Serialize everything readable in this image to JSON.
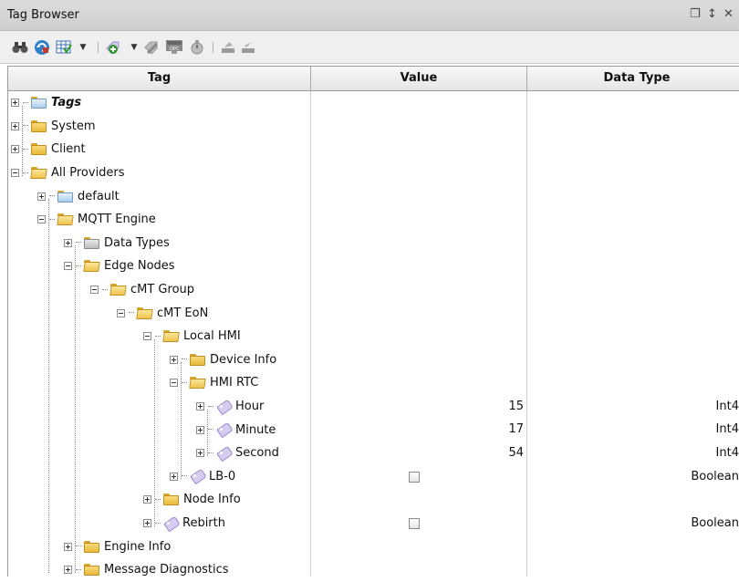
{
  "window": {
    "title": "Tag Browser",
    "restore_icon": "restore-window-icon",
    "pin_icon": "pin-icon",
    "close_icon": "close-icon"
  },
  "toolbar": {
    "buttons": [
      {
        "name": "binoculars-icon"
      },
      {
        "name": "refresh-icon"
      },
      {
        "name": "table-icon"
      },
      {
        "name": "add-tag-icon"
      },
      {
        "name": "edit-tag-icon"
      },
      {
        "name": "opc-browser-icon"
      },
      {
        "name": "tag-history-icon"
      },
      {
        "name": "import-icon"
      },
      {
        "name": "export-icon"
      }
    ]
  },
  "columns": {
    "tag": "Tag",
    "value": "Value",
    "data_type": "Data Type"
  },
  "tree": [
    {
      "label": "Tags",
      "bold": true,
      "expanded": false,
      "icon": "folder-blue-icon",
      "value": "",
      "type": ""
    },
    {
      "label": "System",
      "expanded": false,
      "icon": "folder-icon",
      "value": "",
      "type": ""
    },
    {
      "label": "Client",
      "expanded": false,
      "icon": "folder-icon",
      "value": "",
      "type": ""
    },
    {
      "label": "All Providers",
      "expanded": true,
      "icon": "folder-open-icon",
      "value": "",
      "type": ""
    },
    {
      "label": "default",
      "expanded": false,
      "icon": "folder-blue-icon",
      "value": "",
      "type": ""
    },
    {
      "label": "MQTT Engine",
      "expanded": true,
      "icon": "folder-open-icon",
      "value": "",
      "type": ""
    },
    {
      "label": "Data Types",
      "expanded": false,
      "icon": "folder-gray-icon",
      "value": "",
      "type": ""
    },
    {
      "label": "Edge Nodes",
      "expanded": true,
      "icon": "folder-open-icon",
      "value": "",
      "type": ""
    },
    {
      "label": "cMT Group",
      "expanded": true,
      "icon": "folder-open-icon",
      "value": "",
      "type": ""
    },
    {
      "label": "cMT EoN",
      "expanded": true,
      "icon": "folder-open-icon",
      "value": "",
      "type": ""
    },
    {
      "label": "Local HMI",
      "expanded": true,
      "icon": "folder-open-icon",
      "value": "",
      "type": ""
    },
    {
      "label": "Device Info",
      "expanded": false,
      "icon": "folder-icon",
      "value": "",
      "type": ""
    },
    {
      "label": "HMI RTC",
      "expanded": true,
      "icon": "folder-open-icon",
      "value": "",
      "type": ""
    },
    {
      "label": "Hour",
      "expanded": false,
      "icon": "tag-icon",
      "value": "15",
      "type": "Int4"
    },
    {
      "label": "Minute",
      "expanded": false,
      "icon": "tag-icon",
      "value": "17",
      "type": "Int4"
    },
    {
      "label": "Second",
      "expanded": false,
      "icon": "tag-icon",
      "value": "54",
      "type": "Int4"
    },
    {
      "label": "LB-0",
      "expanded": false,
      "icon": "tag-icon",
      "value": "",
      "checkbox": true,
      "type": "Boolean"
    },
    {
      "label": "Node Info",
      "expanded": false,
      "icon": "folder-icon",
      "value": "",
      "type": ""
    },
    {
      "label": "Rebirth",
      "expanded": false,
      "icon": "tag-icon",
      "value": "",
      "checkbox": true,
      "type": "Boolean"
    },
    {
      "label": "Engine Info",
      "expanded": false,
      "icon": "folder-icon",
      "value": "",
      "type": ""
    },
    {
      "label": "Message Diagnostics",
      "expanded": false,
      "icon": "folder-icon",
      "value": "",
      "type": ""
    }
  ]
}
